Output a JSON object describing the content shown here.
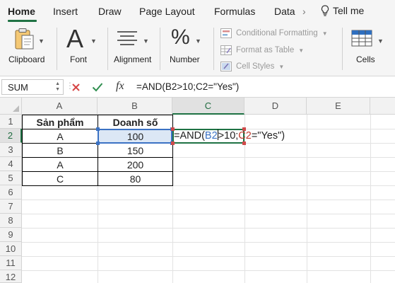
{
  "ribbon_tabs": {
    "home": "Home",
    "insert": "Insert",
    "draw": "Draw",
    "page_layout": "Page Layout",
    "formulas": "Formulas",
    "data": "Data",
    "tell_me": "Tell me"
  },
  "ribbon": {
    "clipboard": "Clipboard",
    "font": "Font",
    "alignment": "Alignment",
    "number": "Number",
    "conditional_formatting": "Conditional Formatting",
    "format_as_table": "Format as Table",
    "cell_styles": "Cell Styles",
    "cells": "Cells",
    "number_icon_text": "%",
    "font_icon_text": "A"
  },
  "formula_bar": {
    "name_box": "SUM",
    "fx": "fx",
    "formula": "=AND(B2>10;C2=\"Yes\")"
  },
  "grid": {
    "columns": [
      "A",
      "B",
      "C",
      "D",
      "E"
    ],
    "rows": [
      "1",
      "2",
      "3",
      "4",
      "5",
      "6",
      "7",
      "8",
      "9",
      "10",
      "11",
      "12"
    ],
    "headers": [
      "Sản phẩm",
      "Doanh số"
    ],
    "table_rows": [
      [
        "A",
        "100"
      ],
      [
        "B",
        "150"
      ],
      [
        "A",
        "200"
      ],
      [
        "C",
        "80"
      ]
    ],
    "editing_cell": {
      "part1": "=AND(",
      "ref1": "B2",
      "part2": ">10;",
      "ref2": "C2",
      "part3": "=\"Yes\")"
    }
  },
  "colors": {
    "accent_green": "#1f7244",
    "ref_blue": "#3b72c4",
    "ref_red": "#c0392b"
  },
  "icons": [
    "lightbulb-icon",
    "clipboard-icon",
    "font-icon",
    "alignment-icon",
    "number-icon",
    "conditional-formatting-icon",
    "format-as-table-icon",
    "cell-styles-icon",
    "cells-icon",
    "cancel-icon",
    "check-icon",
    "fx-icon"
  ]
}
